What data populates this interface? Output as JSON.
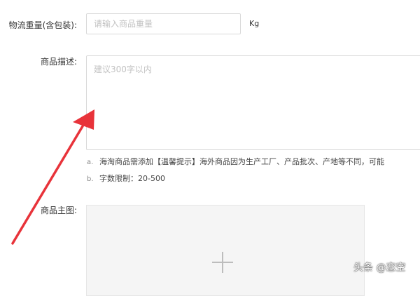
{
  "form": {
    "weight": {
      "label": "物流重量(含包装):",
      "placeholder": "请输入商品重量",
      "unit": "Kg"
    },
    "description": {
      "label": "商品描述:",
      "placeholder": "建议300字以内",
      "hints": [
        {
          "marker": "a.",
          "text": "海淘商品需添加【温馨提示】海外商品因为生产工厂、产品批次、产地等不同，可能"
        },
        {
          "marker": "b.",
          "text": "字数限制：20-500"
        }
      ]
    },
    "main_image": {
      "label": "商品主图:",
      "upload_icon": "plus-icon"
    }
  },
  "annotation": {
    "arrow_color": "#e8333a"
  },
  "watermark": "头条 @恋空"
}
